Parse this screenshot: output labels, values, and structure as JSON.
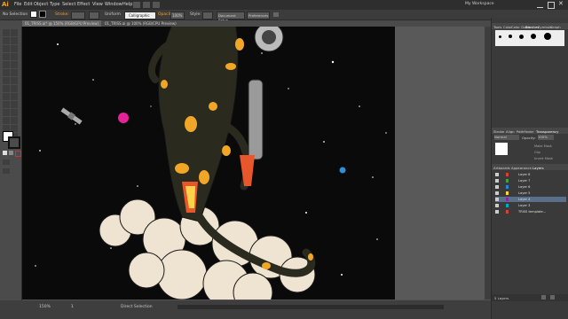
{
  "app": {
    "logo": "Ai",
    "workspace": "My Workspace",
    "menus": [
      "File",
      "Edit",
      "Object",
      "Type",
      "Select",
      "Effect",
      "View",
      "Window",
      "Help"
    ]
  },
  "control": {
    "selection": "No Selection",
    "stroke_label": "Stroke:",
    "stroke_weight": "Uniform",
    "opacity_label": "Opacity:",
    "opacity_value": "100%",
    "style_label": "Style:",
    "doc_setup": "Document Setup",
    "preferences": "Preferences",
    "brush": "Calligraphic"
  },
  "tabs": [
    {
      "label": "01_TRISS.ai* @ 150% (RGB/GPU Preview)",
      "active": true
    },
    {
      "label": "01_TRISS.ai @ 100% (RGB/CPU Preview)",
      "active": false
    }
  ],
  "status": {
    "zoom": "150%",
    "page": "1",
    "tool": "Direct Selection"
  },
  "panels": {
    "top_tabs": [
      "Tools",
      "Color",
      "Color Guide",
      "Brushes",
      "Symbols",
      "Graph Styles"
    ],
    "transparency_tabs": [
      "Stroke",
      "Align",
      "Pathfinder",
      "Transparency"
    ],
    "blend_mode": "Normal",
    "opacity_label": "Opacity:",
    "opacity_value": "100%",
    "make_mask": "Make Mask",
    "clip": "Clip",
    "invert_mask": "Invert Mask",
    "layers_tabs": [
      "Artboards",
      "Appearance",
      "Layers"
    ],
    "layers": [
      "Layer 8",
      "Layer 7",
      "Layer 6",
      "Layer 5",
      "Layer 4",
      "Layer 3",
      "TRISS template..."
    ],
    "layers_count": "5 Layers"
  },
  "colors": {
    "accent": "#f7a21b",
    "canvas": "#0a0a0a",
    "salamander": "#2a2a1f",
    "spots": "#f0a626",
    "cloud": "#efe4d2",
    "planet_magenta": "#e6229a",
    "planet_blue": "#2d8fd8"
  }
}
